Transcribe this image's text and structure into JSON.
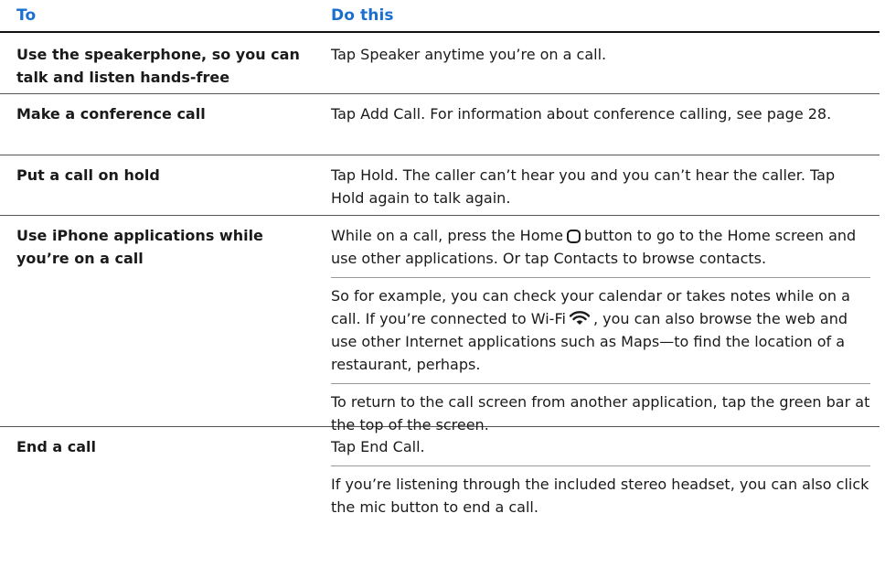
{
  "table": {
    "headers": {
      "to": "To",
      "do": "Do this"
    },
    "rows": [
      {
        "to": "Use the speakerphone, so you can talk and listen hands-free",
        "do": [
          "Tap Speaker anytime you’re on a call."
        ]
      },
      {
        "to": "Make a conference call",
        "do": [
          "Tap Add Call. For information about conference calling, see page 28."
        ]
      },
      {
        "to": "Put a call on hold",
        "do": [
          "Tap Hold. The caller can’t hear you and you can’t hear the caller. Tap Hold again to talk again."
        ]
      },
      {
        "to": "Use iPhone applications while you’re on a call",
        "do_parts": {
          "p1_before": "While on a call, press the Home",
          "p1_after": "button to go to the Home screen and use other applications. Or tap Contacts to browse contacts.",
          "p2_before": "So for example, you can check your calendar or takes notes while on a call. If you’re connected to Wi-Fi",
          "p2_after": ", you can also browse the web and use other Internet applications such as Maps—to find the location of a restaurant, perhaps.",
          "p3": "To return to the call screen from another application, tap the green bar at the top of the screen."
        }
      },
      {
        "to": "End a call",
        "do": [
          "Tap End Call.",
          "If you’re listening through the included stereo headset, you can also click the mic button to end a call."
        ]
      }
    ]
  },
  "icons": {
    "home": "home-button-icon",
    "wifi": "wifi-icon"
  },
  "colors": {
    "header_text": "#1a6fcf"
  }
}
